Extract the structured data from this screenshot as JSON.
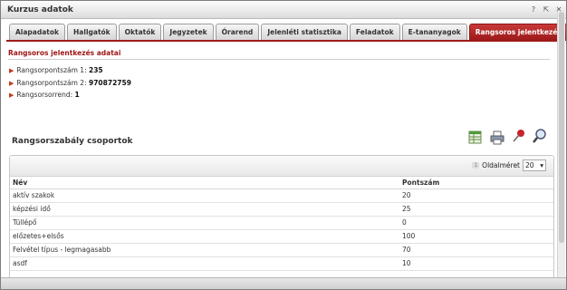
{
  "window": {
    "title": "Kurzus adatok",
    "ctrl_help": "?",
    "ctrl_restore": "⇱",
    "ctrl_close": "✕"
  },
  "tabs": [
    {
      "label": "Alapadatok",
      "active": false
    },
    {
      "label": "Hallgatók",
      "active": false
    },
    {
      "label": "Oktatók",
      "active": false
    },
    {
      "label": "Jegyzetek",
      "active": false
    },
    {
      "label": "Órarend",
      "active": false
    },
    {
      "label": "Jelenléti statisztika",
      "active": false
    },
    {
      "label": "Feladatok",
      "active": false
    },
    {
      "label": "E-tananyagok",
      "active": false
    },
    {
      "label": "Rangsoros jelentkezés",
      "active": true
    }
  ],
  "section": {
    "heading": "Rangsoros jelentkezés adatai",
    "items": [
      {
        "label": "Rangsorpontszám 1:",
        "value": "235"
      },
      {
        "label": "Rangsorpontszám 2:",
        "value": "970872759"
      },
      {
        "label": "Rangsorsorrend:",
        "value": "1"
      }
    ]
  },
  "group": {
    "title": "Rangsorszabály csoportok"
  },
  "toolbar_icons": [
    "excel-export-icon",
    "print-icon",
    "pin-icon",
    "search-icon"
  ],
  "grid": {
    "page_indicator": "1",
    "page_size_label": "Oldalméret",
    "page_size_value": "20",
    "columns": [
      "Név",
      "Pontszám"
    ],
    "rows": [
      [
        "aktív szakok",
        "20"
      ],
      [
        "képzési idő",
        "25"
      ],
      [
        "Tüllépő",
        "0"
      ],
      [
        "előzetes+elsős",
        "100"
      ],
      [
        "Felvétel típus - legmagasabb",
        "70"
      ],
      [
        "asdf",
        "10"
      ]
    ]
  },
  "colors": {
    "accent": "#9e1a1a",
    "section_heading": "#a01818"
  }
}
